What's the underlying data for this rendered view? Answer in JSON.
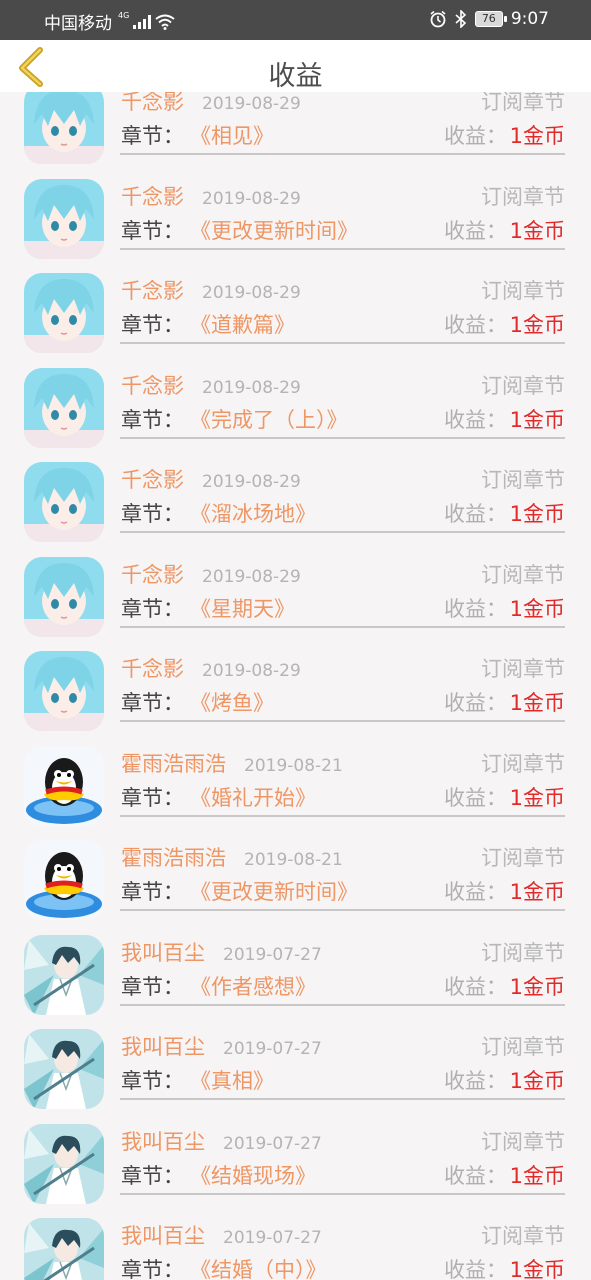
{
  "status_bar": {
    "carrier": "中国移动",
    "network": "4G",
    "battery": "76",
    "time": "9:07"
  },
  "header": {
    "title": "收益",
    "back_icon": "chevron-left-icon"
  },
  "labels": {
    "chapter": "章节：",
    "earnings": "收益："
  },
  "records": [
    {
      "user": "千念影",
      "date": "2019-08-29",
      "type": "订阅章节",
      "chapter": "《相见》",
      "amount": "1金币",
      "avatar": "anime-boy-teal"
    },
    {
      "user": "千念影",
      "date": "2019-08-29",
      "type": "订阅章节",
      "chapter": "《更改更新时间》",
      "amount": "1金币",
      "avatar": "anime-boy-teal"
    },
    {
      "user": "千念影",
      "date": "2019-08-29",
      "type": "订阅章节",
      "chapter": "《道歉篇》",
      "amount": "1金币",
      "avatar": "anime-boy-teal"
    },
    {
      "user": "千念影",
      "date": "2019-08-29",
      "type": "订阅章节",
      "chapter": "《完成了（上）》",
      "amount": "1金币",
      "avatar": "anime-boy-teal"
    },
    {
      "user": "千念影",
      "date": "2019-08-29",
      "type": "订阅章节",
      "chapter": "《溜冰场地》",
      "amount": "1金币",
      "avatar": "anime-boy-teal"
    },
    {
      "user": "千念影",
      "date": "2019-08-29",
      "type": "订阅章节",
      "chapter": "《星期天》",
      "amount": "1金币",
      "avatar": "anime-boy-teal"
    },
    {
      "user": "千念影",
      "date": "2019-08-29",
      "type": "订阅章节",
      "chapter": "《烤鱼》",
      "amount": "1金币",
      "avatar": "anime-boy-teal"
    },
    {
      "user": "霍雨浩雨浩",
      "date": "2019-08-21",
      "type": "订阅章节",
      "chapter": "《婚礼开始》",
      "amount": "1金币",
      "avatar": "penguin"
    },
    {
      "user": "霍雨浩雨浩",
      "date": "2019-08-21",
      "type": "订阅章节",
      "chapter": "《更改更新时间》",
      "amount": "1金币",
      "avatar": "penguin"
    },
    {
      "user": "我叫百尘",
      "date": "2019-07-27",
      "type": "订阅章节",
      "chapter": "《作者感想》",
      "amount": "1金币",
      "avatar": "anime-swordsman"
    },
    {
      "user": "我叫百尘",
      "date": "2019-07-27",
      "type": "订阅章节",
      "chapter": "《真相》",
      "amount": "1金币",
      "avatar": "anime-swordsman"
    },
    {
      "user": "我叫百尘",
      "date": "2019-07-27",
      "type": "订阅章节",
      "chapter": "《结婚现场》",
      "amount": "1金币",
      "avatar": "anime-swordsman"
    },
    {
      "user": "我叫百尘",
      "date": "2019-07-27",
      "type": "订阅章节",
      "chapter": "《结婚（中）》",
      "amount": "1金币",
      "avatar": "anime-swordsman"
    }
  ],
  "colors": {
    "status_bar_bg": "#4a4a4a",
    "accent_orange": "#ee9664",
    "amount_red": "#e02a2a",
    "muted_gray": "#b4b4b4",
    "back_arrow": "#c9a227"
  }
}
